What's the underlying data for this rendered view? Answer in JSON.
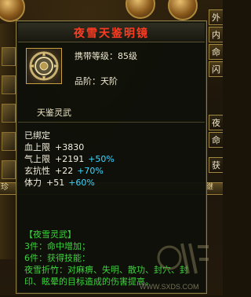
{
  "tooltip": {
    "title": "夜雪天鉴明镜",
    "level": "携带等级：85级",
    "grade": "品阶：天阶",
    "soul_tab": "天鉴灵武",
    "bound": "已绑定",
    "stats": [
      {
        "name": "血上限",
        "value": "+3830",
        "pct": ""
      },
      {
        "name": "气上限",
        "value": "+2191",
        "pct": "+50%"
      },
      {
        "name": "玄抗性",
        "value": "+22",
        "pct": "+70%"
      },
      {
        "name": "体力",
        "value": "+51",
        "pct": "+60%"
      }
    ],
    "set": {
      "name": "【夜雪灵武】",
      "bonus3": "3件：命中增加；",
      "bonus6": "6件：获得技能：",
      "skill_desc": "夜雪折竹：对麻痹、失明、散功、封穴、封印、眩晕的目标造成的伤害提高。"
    }
  },
  "side_tabs": [
    "外",
    "内",
    "命",
    "闪",
    "夜",
    "命",
    "获"
  ],
  "bottom_bar": {
    "left": "珍",
    "right": "继"
  },
  "watermark": {
    "logo": "游侠",
    "url": "WWW.SXDS.COM"
  },
  "colors": {
    "title": "#ff3c22",
    "set_text": "#3ed23e",
    "pct": "#3ad7ff",
    "border": "#8a7a44"
  }
}
